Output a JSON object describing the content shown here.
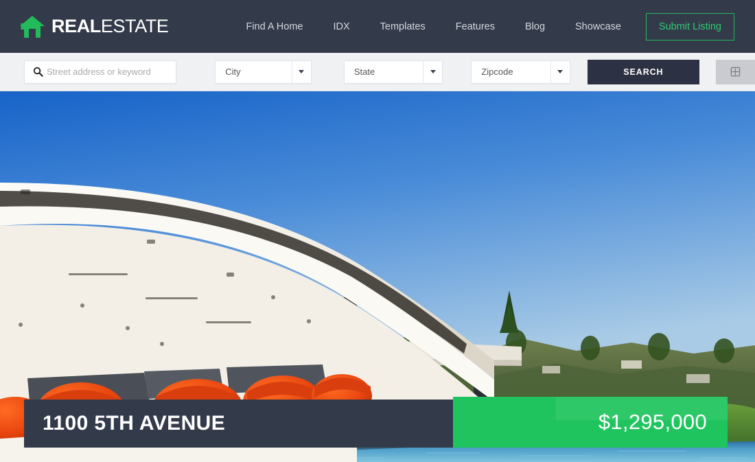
{
  "header": {
    "brand": {
      "bold": "REAL",
      "light": "ESTATE",
      "icon": "home-icon"
    },
    "nav": [
      {
        "label": "Find A Home"
      },
      {
        "label": "IDX"
      },
      {
        "label": "Templates"
      },
      {
        "label": "Features"
      },
      {
        "label": "Blog"
      },
      {
        "label": "Showcase"
      }
    ],
    "cta": {
      "label": "Submit Listing"
    },
    "colors": {
      "background": "#333a4a",
      "accent": "#2ecc71",
      "nav_text": "#d4d8de"
    }
  },
  "search": {
    "keyword_placeholder": "Street address or keyword",
    "keyword_value": "",
    "search_icon": "search-icon",
    "dropdowns": [
      {
        "label": "City"
      },
      {
        "label": "State"
      },
      {
        "label": "Zipcode"
      }
    ],
    "submit_label": "SEARCH",
    "advanced_icon": "grid-view-icon",
    "colors": {
      "bar_background": "#f0f1f3",
      "button": "#2c3243",
      "icon_button": "#c9cbd0"
    }
  },
  "hero": {
    "alt": "Luxury modern home interior with orange lounge chairs opening onto infinity pool and hillside view"
  },
  "listing": {
    "address": "1100 5TH AVENUE",
    "price": "$1,295,000",
    "colors": {
      "address_panel": "#333a4a",
      "price_panel": "#20c45e"
    }
  }
}
